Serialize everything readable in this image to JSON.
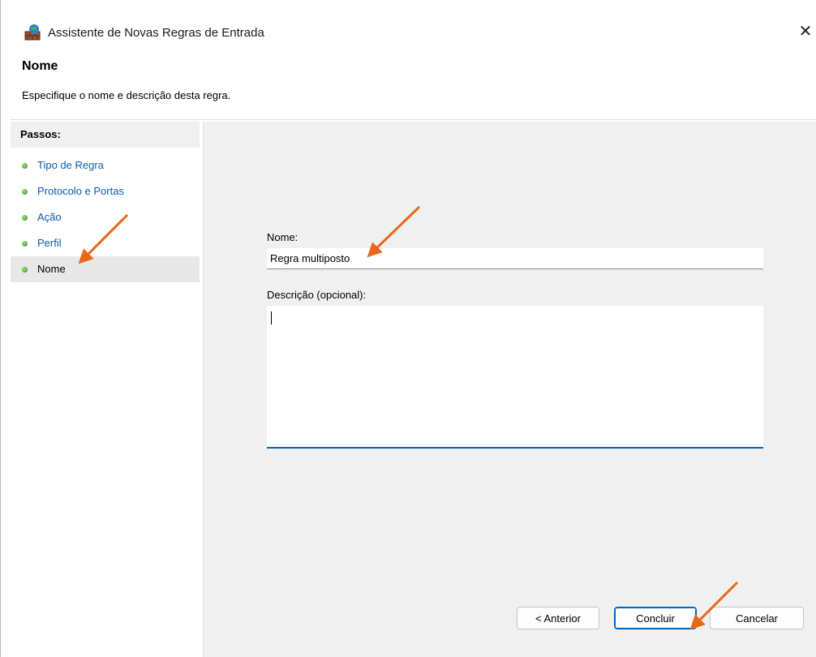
{
  "window": {
    "title": "Assistente de Novas Regras de Entrada",
    "close_glyph": "✕",
    "icon": "firewall-icon"
  },
  "header": {
    "title": "Nome",
    "subtitle": "Especifique o nome e descrição desta regra."
  },
  "sidebar": {
    "heading": "Passos:",
    "steps": [
      {
        "label": "Tipo de Regra"
      },
      {
        "label": "Protocolo e Portas"
      },
      {
        "label": "Ação"
      },
      {
        "label": "Perfil"
      },
      {
        "label": "Nome",
        "current": true
      }
    ]
  },
  "form": {
    "name_label": "Nome:",
    "name_value": "Regra multiposto",
    "description_label": "Descrição (opcional):",
    "description_value": ""
  },
  "buttons": {
    "back": "< Anterior",
    "finish": "Concluir",
    "cancel": "Cancelar"
  },
  "colors": {
    "accent": "#0067c0",
    "link": "#0b5cad",
    "annotation_arrow": "#e8671a",
    "step_dot": "#3a9a2a"
  }
}
